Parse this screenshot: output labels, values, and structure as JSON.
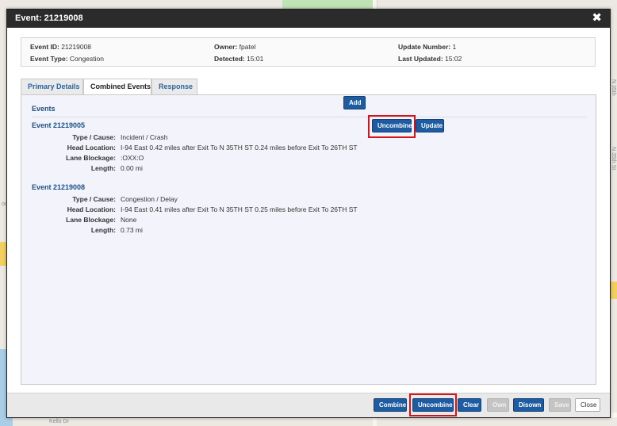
{
  "dialog": {
    "title": "Event: 21219008",
    "close_glyph": "✖"
  },
  "summary": {
    "event_id_label": "Event ID:",
    "event_id": "21219008",
    "event_type_label": "Event Type:",
    "event_type": "Congestion",
    "owner_label": "Owner:",
    "owner": "fpatel",
    "detected_label": "Detected:",
    "detected": "15:01",
    "update_number_label": "Update Number:",
    "update_number": "1",
    "last_updated_label": "Last Updated:",
    "last_updated": "15:02"
  },
  "tabs": [
    {
      "label": "Primary Details",
      "active": false
    },
    {
      "label": "Combined Events",
      "active": true
    },
    {
      "label": "Response",
      "active": false
    }
  ],
  "panel": {
    "heading": "Events",
    "add_label": "Add",
    "uncombine_label": "Uncombine",
    "update_label": "Update"
  },
  "events": [
    {
      "title": "Event 21219005",
      "type_cause_label": "Type / Cause:",
      "type_cause": "Incident / Crash",
      "head_location_label": "Head Location:",
      "head_location": "I-94 East 0.42 miles after Exit To N 35TH ST 0.24 miles before Exit To 26TH ST",
      "lane_blockage_label": "Lane Blockage:",
      "lane_blockage": ":OXX:O",
      "length_label": "Length:",
      "length": "0.00 mi"
    },
    {
      "title": "Event 21219008",
      "type_cause_label": "Type / Cause:",
      "type_cause": "Congestion / Delay",
      "head_location_label": "Head Location:",
      "head_location": "I-94 East 0.41 miles after Exit To N 35TH ST 0.25 miles before Exit To 26TH ST",
      "lane_blockage_label": "Lane Blockage:",
      "lane_blockage": "None",
      "length_label": "Length:",
      "length": "0.73 mi"
    }
  ],
  "footer": {
    "combine": "Combine",
    "uncombine": "Uncombine",
    "clear": "Clear",
    "own": "Own",
    "disown": "Disown",
    "save": "Save",
    "close": "Close"
  },
  "map_labels": {
    "left_edge": "or",
    "right_top": "N 35th",
    "right_mid": "N 35th St",
    "bottom_left": "Kello Dr"
  },
  "colors": {
    "title_bar": "#2b2b2b",
    "primary_button": "#1d5ba3",
    "heading_blue": "#1d4f87",
    "highlight_red": "#d4141c",
    "disabled_button": "#c4c4c4"
  }
}
